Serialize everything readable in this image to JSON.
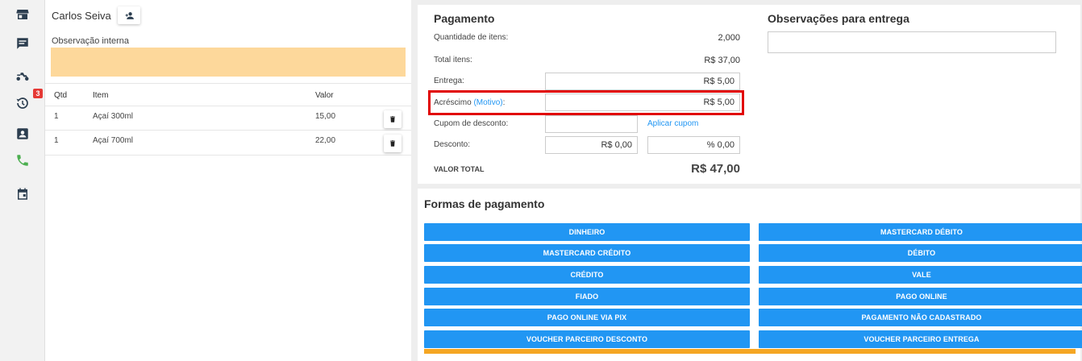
{
  "sidebar": {
    "icons": [
      "store-icon",
      "chat-icon",
      "delivery-bike-icon",
      "history-icon",
      "contact-card-icon",
      "phone-icon",
      "calendar-icon"
    ],
    "history_badge": "3",
    "colors": {
      "icon": "#2c3e50",
      "phone": "#4caf50",
      "badge": "#e53935"
    }
  },
  "customer": {
    "name": "Carlos Seiva"
  },
  "internal_note": {
    "label": "Observação interna",
    "value": ""
  },
  "items_table": {
    "headers": {
      "qty": "Qtd",
      "item": "Item",
      "value": "Valor"
    },
    "rows": [
      {
        "qty": "1",
        "item": "Açaí 300ml",
        "value": "15,00"
      },
      {
        "qty": "1",
        "item": "Açaí 700ml",
        "value": "22,00"
      }
    ]
  },
  "payment": {
    "title": "Pagamento",
    "quantity_label": "Quantidade de itens:",
    "quantity_value": "2,000",
    "total_items_label": "Total itens:",
    "total_items_value": "R$ 37,00",
    "delivery_label": "Entrega:",
    "delivery_value": "R$ 5,00",
    "surcharge_label": "Acréscimo",
    "surcharge_reason_link": "(Motivo)",
    "surcharge_colon": ":",
    "surcharge_value": "R$ 5,00",
    "coupon_label": "Cupom de desconto:",
    "coupon_value": "",
    "apply_coupon_link": "Aplicar cupom",
    "discount_label": "Desconto:",
    "discount_value": "R$ 0,00",
    "discount_percent": "% 0,00",
    "total_label": "VALOR TOTAL",
    "total_value": "R$ 47,00"
  },
  "delivery_notes": {
    "title": "Observações para entrega",
    "value": ""
  },
  "payment_methods": {
    "title": "Formas de pagamento",
    "left": [
      "DINHEIRO",
      "MASTERCARD CRÉDITO",
      "CRÉDITO",
      "FIADO",
      "PAGO ONLINE VIA PIX",
      "VOUCHER PARCEIRO DESCONTO"
    ],
    "right": [
      "MASTERCARD DÉBITO",
      "DÉBITO",
      "VALE",
      "PAGO ONLINE",
      "PAGAMENTO NÃO CADASTRADO",
      "VOUCHER PARCEIRO ENTREGA"
    ],
    "colors": {
      "button": "#2196f3",
      "accent": "#f5a623"
    }
  }
}
